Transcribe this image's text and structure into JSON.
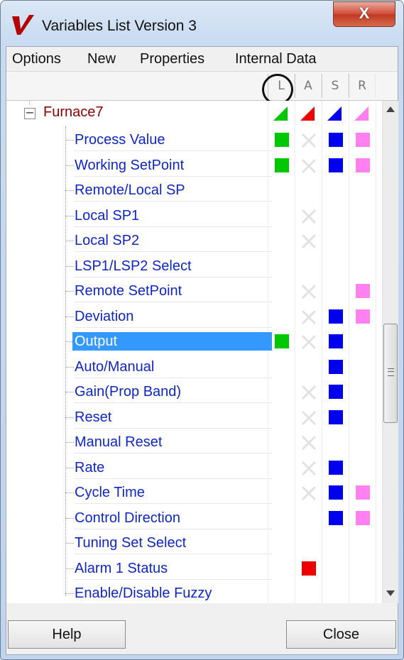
{
  "window": {
    "title": "Variables List Version 3",
    "close_glyph": "X"
  },
  "menu": [
    "Options",
    "New",
    "Properties",
    "Internal Data"
  ],
  "columns": [
    "L",
    "A",
    "S",
    "R"
  ],
  "tree": {
    "root": {
      "label": "Furnace7",
      "expand_glyph": "−",
      "color": "#8b0000"
    },
    "items": [
      {
        "label": "Process Value",
        "flags": [
          "green",
          "x",
          "blue",
          "pink"
        ]
      },
      {
        "label": "Working SetPoint",
        "flags": [
          "green",
          "x",
          "blue",
          "pink"
        ]
      },
      {
        "label": "Remote/Local SP",
        "flags": [
          "",
          "",
          "",
          ""
        ]
      },
      {
        "label": "Local SP1",
        "flags": [
          "",
          "x",
          "",
          ""
        ]
      },
      {
        "label": "Local SP2",
        "flags": [
          "",
          "x",
          "",
          ""
        ]
      },
      {
        "label": "LSP1/LSP2 Select",
        "flags": [
          "",
          "",
          "",
          ""
        ]
      },
      {
        "label": "Remote SetPoint",
        "flags": [
          "",
          "x",
          "",
          "pink"
        ]
      },
      {
        "label": "Deviation",
        "flags": [
          "",
          "x",
          "blue",
          "pink"
        ]
      },
      {
        "label": "Output",
        "flags": [
          "green",
          "x",
          "blue",
          ""
        ],
        "selected": true
      },
      {
        "label": "Auto/Manual",
        "flags": [
          "",
          "",
          "blue",
          ""
        ]
      },
      {
        "label": "Gain(Prop Band)",
        "flags": [
          "",
          "x",
          "blue",
          ""
        ]
      },
      {
        "label": "Reset",
        "flags": [
          "",
          "x",
          "blue",
          ""
        ]
      },
      {
        "label": "Manual Reset",
        "flags": [
          "",
          "x",
          "",
          ""
        ]
      },
      {
        "label": "Rate",
        "flags": [
          "",
          "x",
          "blue",
          ""
        ]
      },
      {
        "label": "Cycle Time",
        "flags": [
          "",
          "x",
          "blue",
          "pink"
        ]
      },
      {
        "label": "Control Direction",
        "flags": [
          "",
          "",
          "blue",
          "pink"
        ]
      },
      {
        "label": "Tuning Set Select",
        "flags": [
          "",
          "",
          "",
          ""
        ]
      },
      {
        "label": "Alarm 1 Status",
        "flags": [
          "",
          "red",
          "",
          ""
        ]
      },
      {
        "label": "Enable/Disable Fuzzy",
        "flags": [
          "",
          "",
          "",
          ""
        ]
      }
    ]
  },
  "colors": {
    "green": "#00c800",
    "red": "#ee0000",
    "blue": "#0000ee",
    "pink": "#ff80ee",
    "selection": "#3399ff",
    "item_text": "#0f27c2"
  },
  "buttons": {
    "help": "Help",
    "close": "Close"
  }
}
